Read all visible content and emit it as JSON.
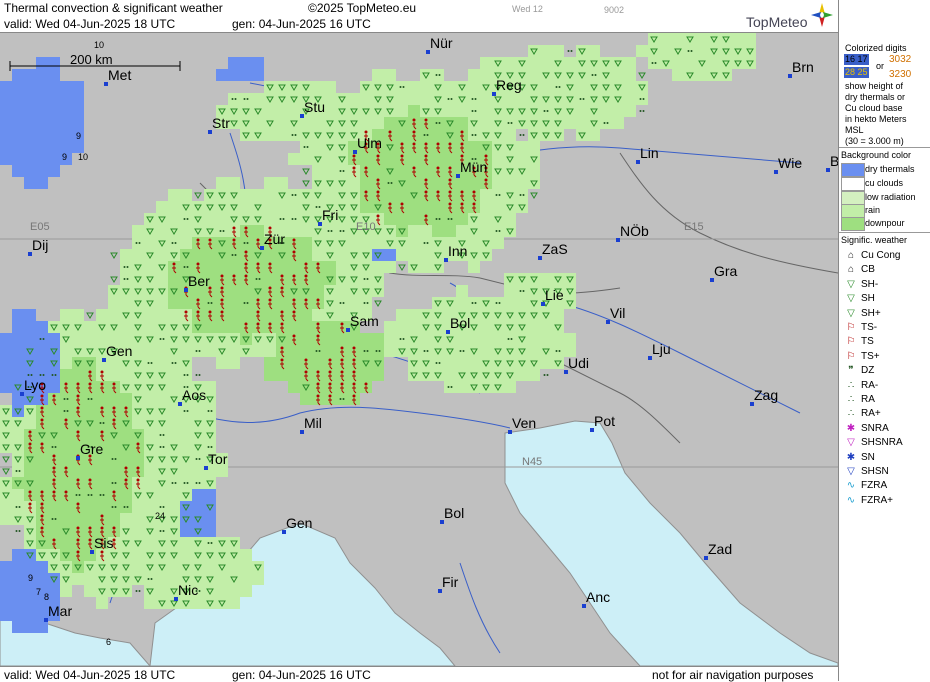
{
  "header": {
    "title": "Thermal convection & significant weather",
    "copyright": "©2025 TopMeteo.eu",
    "valid": "valid:  Wed  04-Jun-2025  18 UTC",
    "gen": "gen: 04-Jun-2025 16 UTC",
    "faint_day": "Wed 12",
    "faint_code": "9002",
    "logo": "TopMeteo"
  },
  "footer": {
    "valid": "valid:  Wed  04-Jun-2025  18 UTC",
    "gen": "gen: 04-Jun-2025 16 UTC",
    "disclaimer": "not for air navigation purposes"
  },
  "map": {
    "scale_label": "200 km",
    "grid_labels": [
      "E05",
      "E10",
      "E15",
      "N45"
    ],
    "cities": [
      "Nür",
      "Brn",
      "Reg",
      "Met",
      "Stu",
      "Str",
      "Ulm",
      "Lin",
      "Mün",
      "Wie",
      "B",
      "Fri",
      "Dij",
      "Zür",
      "Inn",
      "ZaS",
      "NÖb",
      "Gra",
      "Ber",
      "Lie",
      "Vil",
      "Sam",
      "Bol",
      "Gen",
      "Lju",
      "Udi",
      "Lyo",
      "Aos",
      "Zag",
      "Mil",
      "Ven",
      "Pot",
      "Gre",
      "Tor",
      "Gen",
      "Bol",
      "Sis",
      "Zad",
      "Nic",
      "Fir",
      "Mar",
      "Anc"
    ],
    "digits": [
      "10",
      "9",
      "9",
      "10",
      "24",
      "9",
      "7",
      "8",
      "6"
    ],
    "colors": {
      "land": "#c0c0c0",
      "sea": "#cdeff7",
      "dry_thermals": "#6a8ff0",
      "cu_clouds": "#ffffff",
      "low_radiation": "#d4f0c0",
      "rain": "#c2eea8",
      "downpour": "#9edf80",
      "ts_symbol": "#b00000",
      "sh_symbol": "#2a8a2a"
    }
  },
  "sidebar": {
    "colorized_title": "Colorized digits",
    "sample_a": "16 17",
    "sample_b": "28 25",
    "or_label": "or",
    "sample_c": "3032",
    "sample_d": "3230",
    "desc1": "show height of",
    "desc2": "dry thermals or",
    "desc3": "Cu cloud base",
    "desc4": "in hekto Meters",
    "desc5": "MSL",
    "desc6": "(30 = 3.000 m)",
    "bg_title": "Background color",
    "bg_items": [
      "dry thermals",
      "cu clouds",
      "low radiation",
      "rain",
      "downpour"
    ],
    "sig_title": "Signific. weather",
    "sig_items": [
      "Cu Cong",
      "CB",
      "SH-",
      "SH",
      "SH+",
      "TS-",
      "TS",
      "TS+",
      "DZ",
      "RA-",
      "RA",
      "RA+",
      "SNRA",
      "SHSNRA",
      "SN",
      "SHSN",
      "FZRA",
      "FZRA+"
    ]
  }
}
